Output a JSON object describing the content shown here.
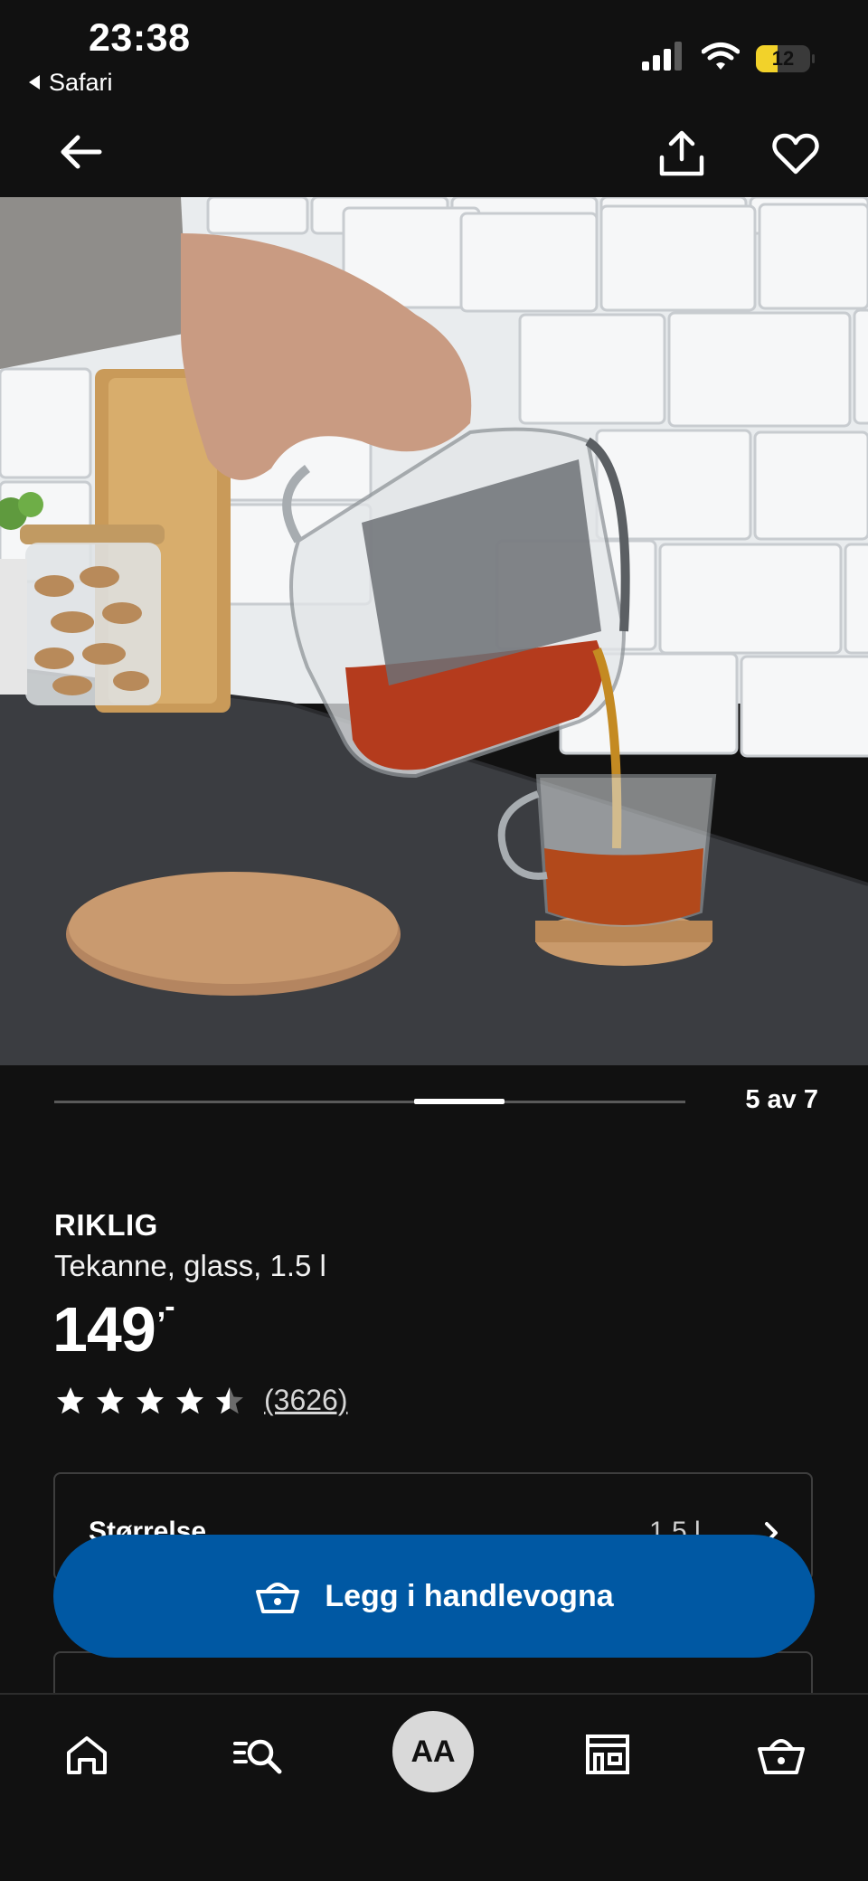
{
  "status_bar": {
    "time": "23:38",
    "back_app": "Safari",
    "battery": "12"
  },
  "gallery": {
    "counter": "5 av 7",
    "current_index": 5,
    "total": 7
  },
  "product": {
    "name": "RIKLIG",
    "description": "Tekanne, glass, 1.5 l",
    "price": "149",
    "price_suffix": ",-",
    "rating": 4.5,
    "rating_count": "(3626)"
  },
  "size_selector": {
    "label": "Størrelse",
    "value": "1.5 l"
  },
  "add_to_cart": {
    "label": "Legg i handlevogna"
  },
  "tab_bar": {
    "avatar_initials": "AA"
  },
  "colors": {
    "background": "#111111",
    "accent": "#0058a3"
  }
}
